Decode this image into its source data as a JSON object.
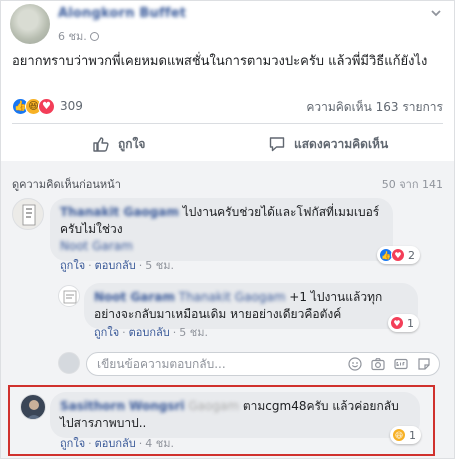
{
  "post": {
    "author": "Alongkorn Buffet",
    "time": "6 ชม.",
    "text": "อยากทราบว่าพวกพี่เคยหมดแพสชั่นในการตามวงปะครับ แล้วพี่มีวิธีแก้ยังไง",
    "reaction_count": "309",
    "comment_count": "ความคิดเห็น 163 รายการ"
  },
  "actions": {
    "like": "ถูกใจ",
    "comment": "แสดงความคิดเห็น"
  },
  "comments_header": {
    "prev": "ดูความคิดเห็นก่อนหน้า",
    "count": "50 จาก 141"
  },
  "comments": [
    {
      "name": "Thanakit Gaogam",
      "text": "ไปงานครับช่วยได้และโฟกัสที่เมมเบอร์ครับไม่ใช่วง",
      "tag": "Noot Garam",
      "like": "ถูกใจ",
      "reply": "ตอบกลับ",
      "time": "5 ชม.",
      "reaction_count": "2"
    },
    {
      "name": "Noot Garam",
      "mention": "Thanakit Gaogam",
      "text": "+1 ไปงานแล้วทุกอย่างจะกลับมาเหมือนเดิม หายอย่างเดียวคือตังค์",
      "like": "ถูกใจ",
      "reply": "ตอบกลับ",
      "time": "5 ชม.",
      "reaction_count": "1"
    },
    {
      "name": "Sasithorn Wongsri",
      "hidden": "Gaogam",
      "text": "ตามcgm48ครับ แล้วค่อยกลับไปสารภาพบาป..",
      "like": "ถูกใจ",
      "reply": "ตอบกลับ",
      "time": "4 ชม.",
      "reaction_count": "1"
    }
  ],
  "reply_box": {
    "placeholder": "เขียนข้อความตอบกลับ..."
  },
  "colors": {
    "link": "#385898",
    "like_blue": "#1877f2",
    "haha_yellow": "#f7b125",
    "love_red": "#f33e58",
    "highlight_red": "#d0312d"
  }
}
